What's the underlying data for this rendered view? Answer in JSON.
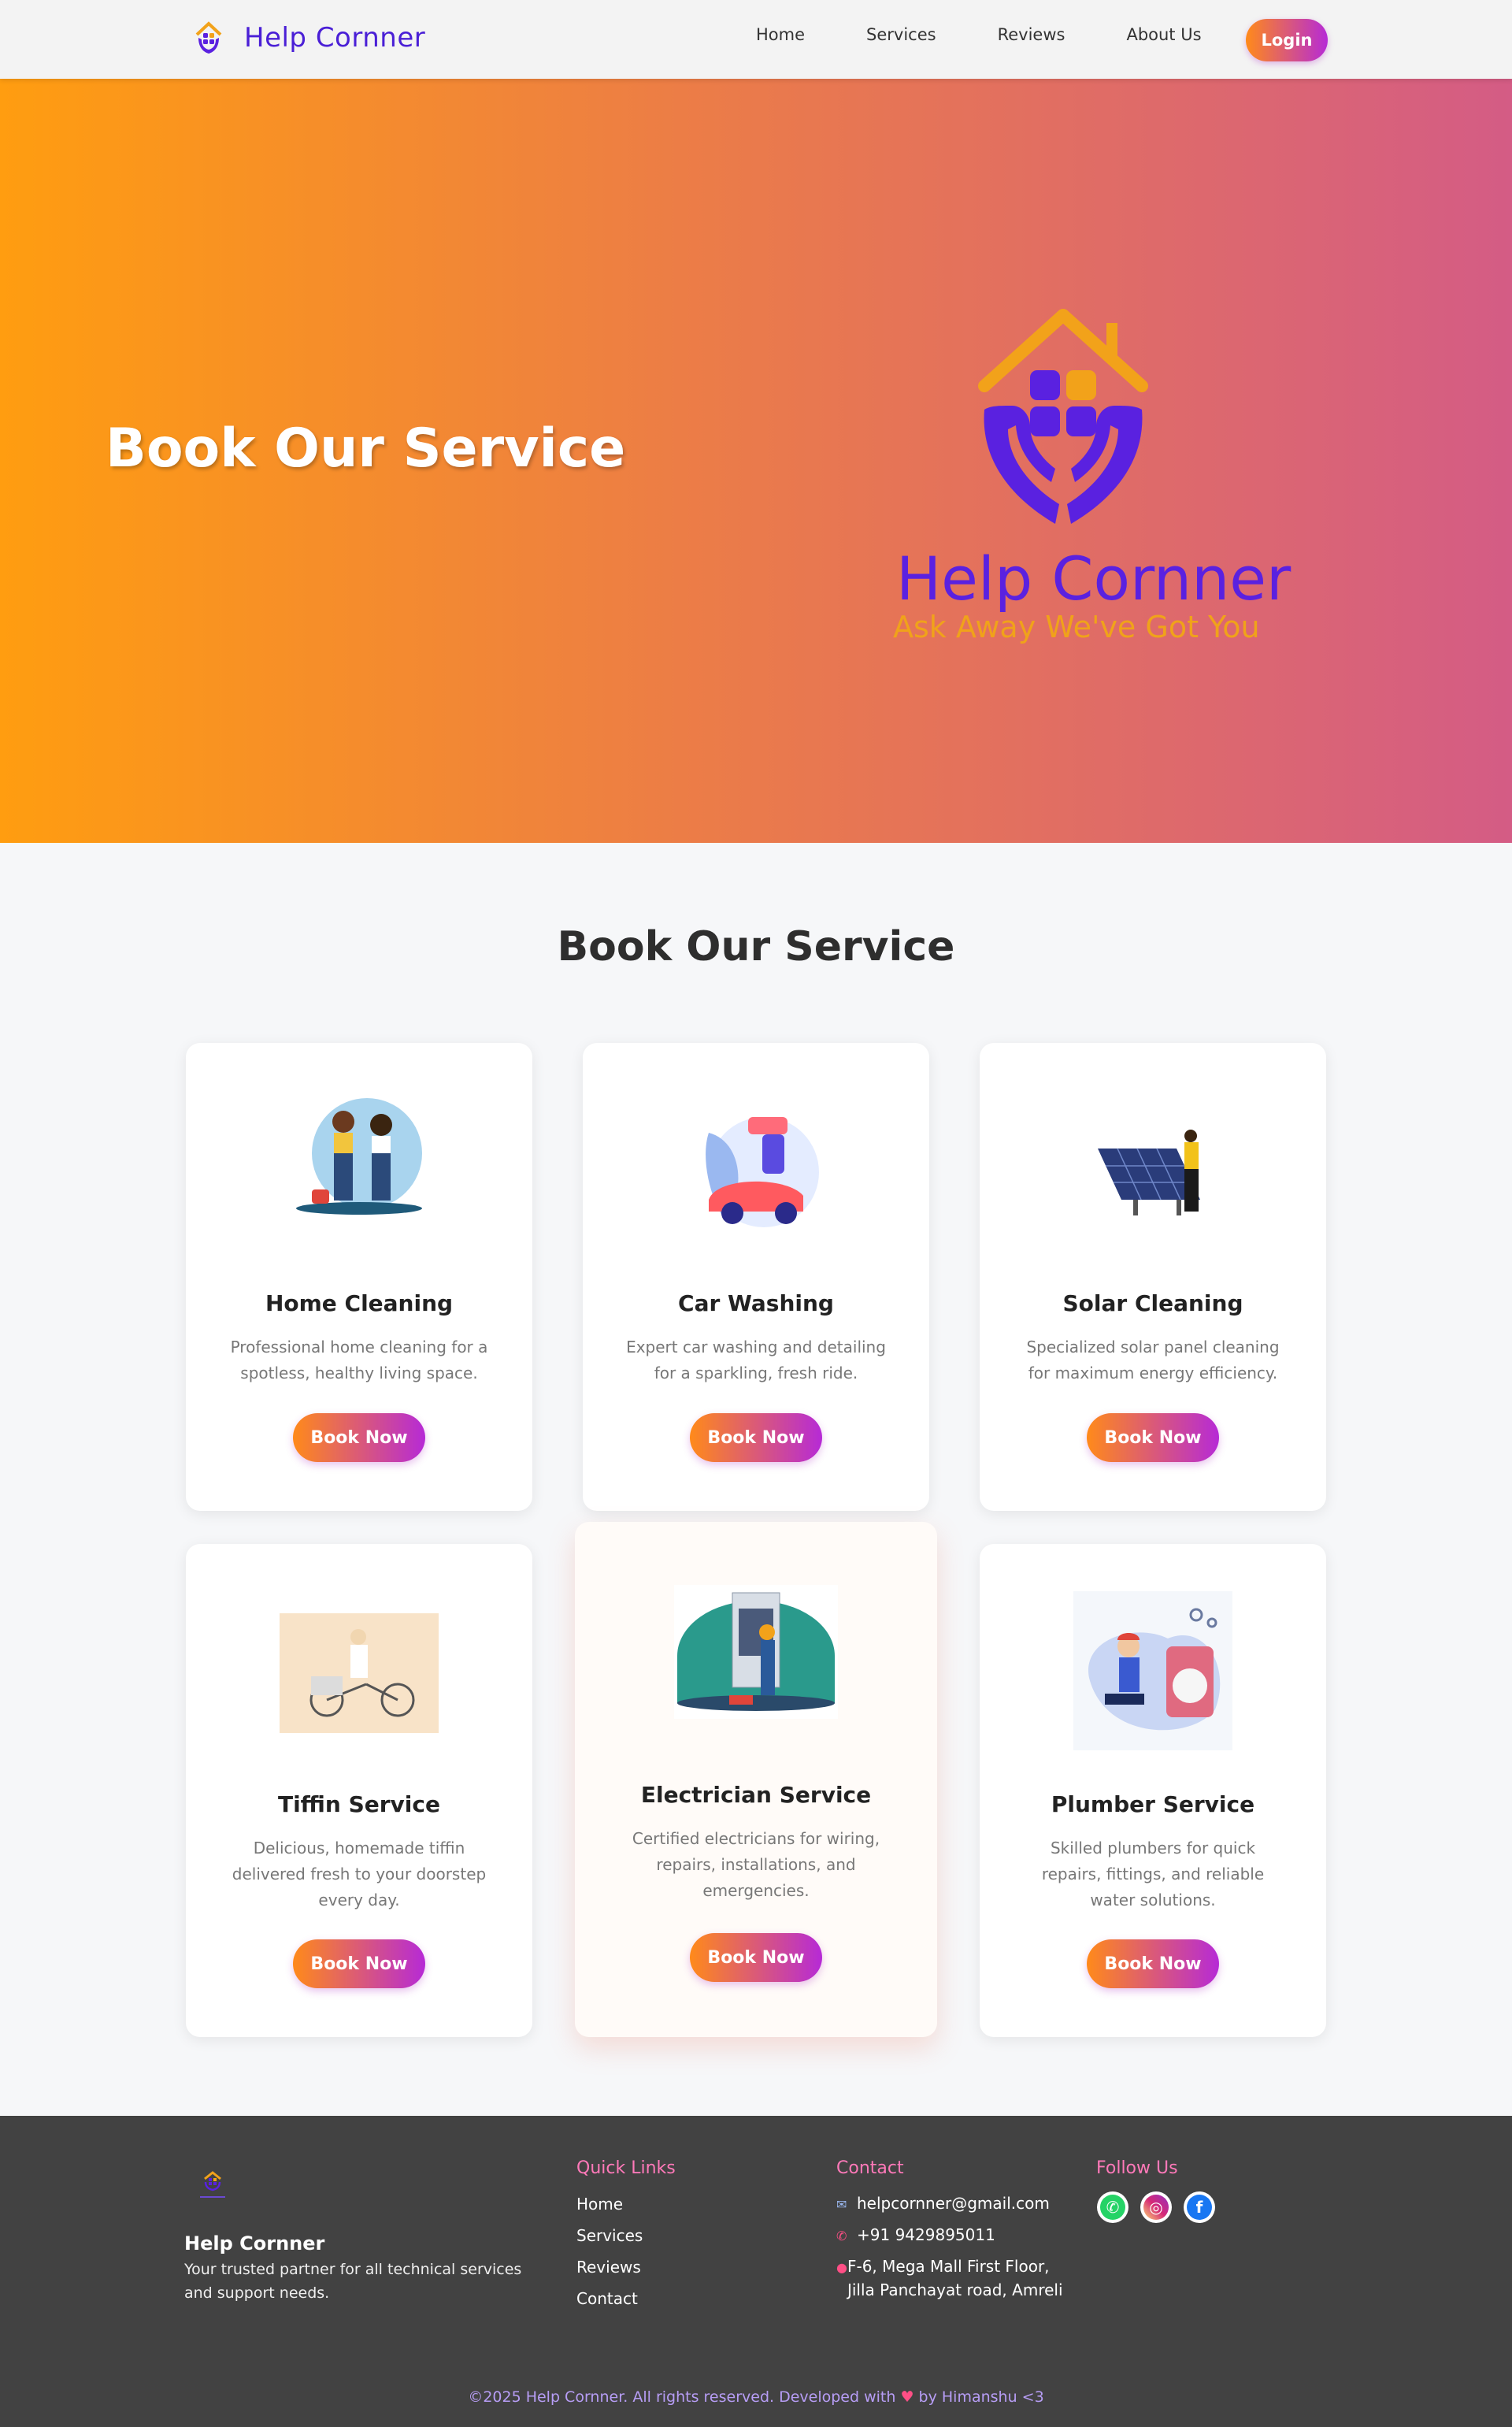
{
  "nav": {
    "brand": "Help Cornner",
    "links": [
      "Home",
      "Services",
      "Reviews",
      "About Us"
    ],
    "login": "Login"
  },
  "hero": {
    "title": "Book Our Service",
    "logo_name": "Help Cornner",
    "logo_tagline": "Ask Away  We've Got You"
  },
  "services": {
    "heading": "Book Our Service",
    "cards": [
      {
        "title": "Home Cleaning",
        "desc": "Professional home cleaning for a spotless, healthy living space.",
        "button": "Book Now",
        "icon": "home-cleaning-illustration"
      },
      {
        "title": "Car Washing",
        "desc": "Expert car washing and detailing for a sparkling, fresh ride.",
        "button": "Book Now",
        "icon": "car-washing-illustration"
      },
      {
        "title": "Solar Cleaning",
        "desc": "Specialized solar panel cleaning for maximum energy efficiency.",
        "button": "Book Now",
        "icon": "solar-cleaning-illustration"
      },
      {
        "title": "Tiffin Service",
        "desc": "Delicious, homemade tiffin delivered fresh to your doorstep every day.",
        "button": "Book Now",
        "icon": "tiffin-delivery-illustration"
      },
      {
        "title": "Electrician Service",
        "desc": "Certified electricians for wiring, repairs, installations, and emergencies.",
        "button": "Book Now",
        "icon": "electrician-illustration"
      },
      {
        "title": "Plumber Service",
        "desc": "Skilled plumbers for quick repairs, fittings, and reliable water solutions.",
        "button": "Book Now",
        "icon": "plumber-illustration"
      }
    ]
  },
  "footer": {
    "brand": "Help Cornner",
    "about": "Your trusted partner for all technical services and support needs.",
    "quick_links_title": "Quick Links",
    "quick_links": [
      "Home",
      "Services",
      "Reviews",
      "Contact"
    ],
    "contact_title": "Contact",
    "email": "helpcornner@gmail.com",
    "phone": "+91 9429895011",
    "address": "F-6, Mega Mall First Floor, Jilla Panchayat road, Amreli",
    "follow_title": "Follow Us",
    "copyright_pre": "©2025 Help Cornner. All rights reserved. Developed with",
    "copyright_post": "by Himanshu <3"
  },
  "colors": {
    "brand_purple": "#4a1fd6",
    "accent_orange": "#ff9d10",
    "accent_pink": "#d45c85",
    "button_gradient_start": "#ff8a1a",
    "button_gradient_end": "#b62ad6",
    "footer_bg": "#424242"
  }
}
